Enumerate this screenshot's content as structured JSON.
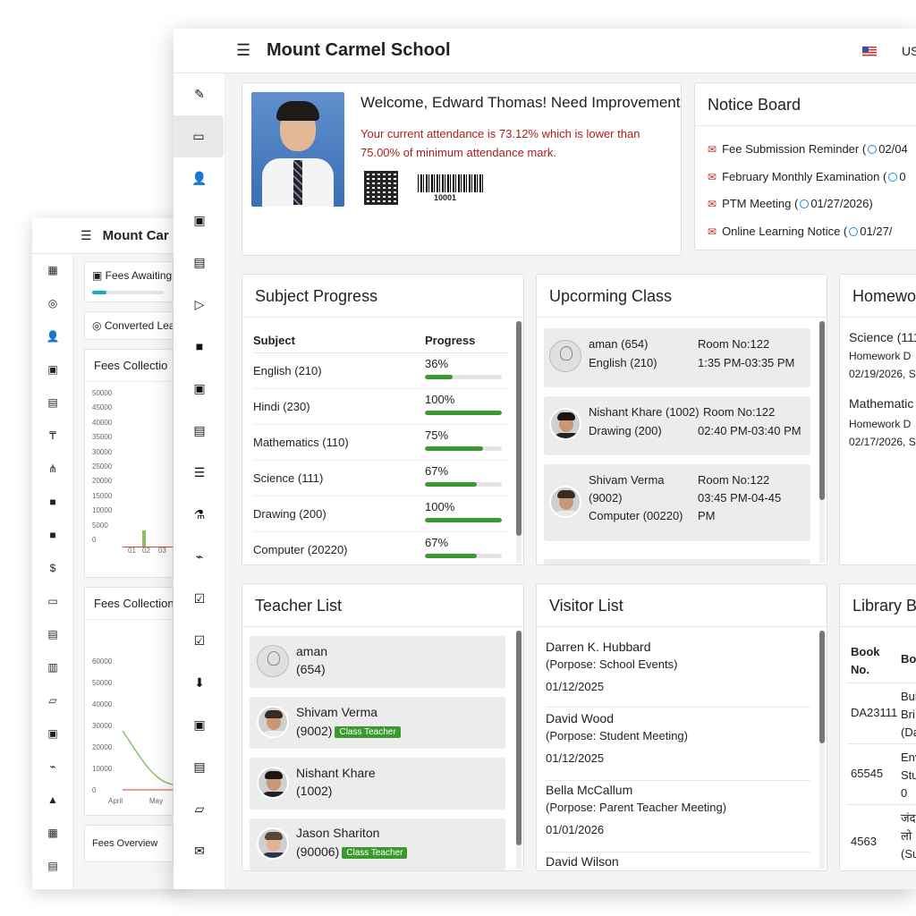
{
  "app": {
    "title": "Mount Carmel School",
    "language": "US"
  },
  "back_window": {
    "title": "Mount Car",
    "cards": [
      {
        "label": "Fees Awaiting",
        "icon": "money-icon",
        "progress": 0.2
      },
      {
        "label": "Converted Lea",
        "icon": "target-icon"
      }
    ],
    "chart1": {
      "title": "Fees Collectio",
      "yticks": [
        "50000",
        "45000",
        "40000",
        "35000",
        "30000",
        "25000",
        "20000",
        "15000",
        "10000",
        "5000",
        "0"
      ],
      "xticks": [
        "01",
        "02",
        "03"
      ]
    },
    "chart2": {
      "title": "Fees Collection",
      "yticks": [
        "60000",
        "50000",
        "40000",
        "30000",
        "20000",
        "10000",
        "0"
      ],
      "xticks": [
        "April",
        "May"
      ]
    },
    "footer_card": "Fees Overview"
  },
  "welcome": {
    "title": "Welcome, Edward Thomas! Need Improvement.",
    "warning": "Your current attendance is 73.12% which is lower than 75.00% of minimum attendance mark.",
    "barcode_number": "10001"
  },
  "notice_board": {
    "title": "Notice Board",
    "items": [
      {
        "text": "Fee Submission Reminder (",
        "date": "02/04"
      },
      {
        "text": "February Monthly Examination (",
        "date": "0"
      },
      {
        "text": "PTM Meeting (",
        "date": "01/27/2026)"
      },
      {
        "text": "Online Learning Notice (",
        "date": "01/27/"
      }
    ]
  },
  "subject_progress": {
    "title": "Subject Progress",
    "col_subject": "Subject",
    "col_progress": "Progress",
    "rows": [
      {
        "subject": "English (210)",
        "progress": "36%",
        "value": 36
      },
      {
        "subject": "Hindi (230)",
        "progress": "100%",
        "value": 100
      },
      {
        "subject": "Mathematics (110)",
        "progress": "75%",
        "value": 75
      },
      {
        "subject": "Science (111)",
        "progress": "67%",
        "value": 67
      },
      {
        "subject": "Drawing (200)",
        "progress": "100%",
        "value": 100
      },
      {
        "subject": "Computer (20220)",
        "progress": "67%",
        "value": 67
      }
    ]
  },
  "upcoming_class": {
    "title": "Upcorming Class",
    "items": [
      {
        "name": "aman (654)",
        "subject": "English (210)",
        "room": "Room No:122",
        "time": "1:35 PM-03:35 PM"
      },
      {
        "name": "Nishant Khare (1002)",
        "subject": "Drawing (200)",
        "room": "Room No:122",
        "time": "02:40 PM-03:40 PM"
      },
      {
        "name": "Shivam Verma",
        "name2": "(9002)",
        "subject": "Computer (00220)",
        "room": "Room No:122",
        "time": "03:45 PM-04-45",
        "time2": "PM"
      }
    ]
  },
  "homework": {
    "title": "Homewor",
    "items": [
      {
        "subject": "Science (111",
        "line": "Homework D",
        "date": "02/19/2026, S"
      },
      {
        "subject": "Mathematic",
        "line": "Homework D",
        "date": "02/17/2026, S"
      }
    ]
  },
  "teacher_list": {
    "title": "Teacher List",
    "items": [
      {
        "name": "aman",
        "id": "(654)",
        "badge": ""
      },
      {
        "name": "Shivam Verma",
        "id": "(9002)",
        "badge": "Class Teacher"
      },
      {
        "name": "Nishant Khare",
        "id": "(1002)",
        "badge": ""
      },
      {
        "name": "Jason Shariton",
        "id": "(90006)",
        "badge": "Class Teacher"
      }
    ]
  },
  "visitor_list": {
    "title": "Visitor List",
    "items": [
      {
        "name": "Darren K. Hubbard",
        "purpose": "(Porpose: School Events)",
        "date": "01/12/2025"
      },
      {
        "name": "David Wood",
        "purpose": "(Porpose: Student Meeting)",
        "date": "01/12/2025"
      },
      {
        "name": "Bella McCallum",
        "purpose": "(Porpose: Parent Teacher Meeting)",
        "date": "01/01/2026"
      },
      {
        "name": "David Wilson",
        "purpose": "",
        "date": ""
      }
    ]
  },
  "library": {
    "title": "Library Bo",
    "col_book_no": "Book No.",
    "col_book": "Boo",
    "rows": [
      {
        "no": "DA23111",
        "l1": "Bui",
        "l2": "Bri",
        "l3": "(Da"
      },
      {
        "no": "65545",
        "l1": "Env",
        "l2": "Stu",
        "l3": "0"
      },
      {
        "no": "4563",
        "l1": "जंद",
        "l2": "लो",
        "l3": "(Su"
      }
    ]
  }
}
